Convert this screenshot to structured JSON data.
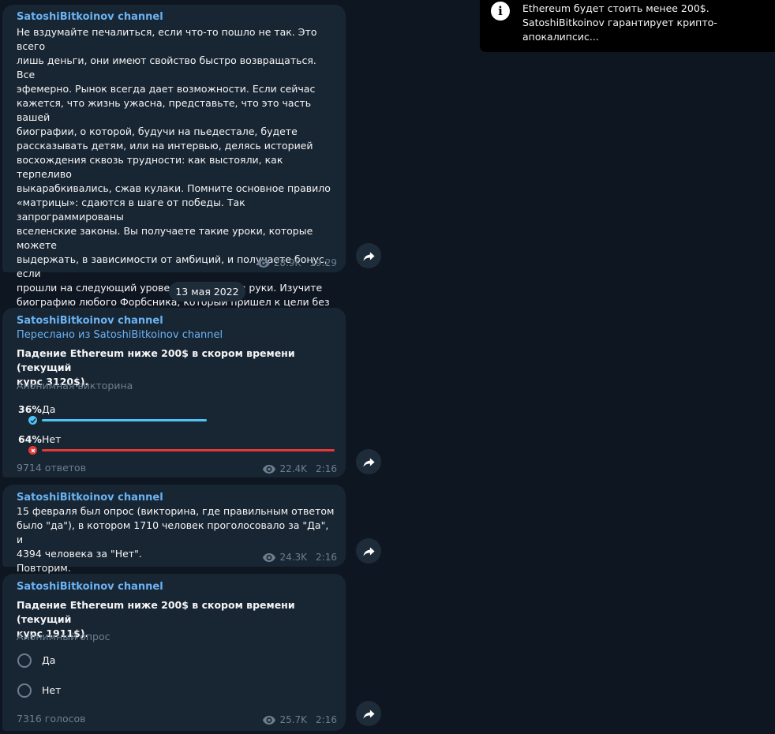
{
  "toast": {
    "icon": "info-icon",
    "text": "Ethereum будет стоить менее 200$.\nSatoshiBitkoinov гарантирует крипто-апокалипсис..."
  },
  "date_separator": "13 мая 2022",
  "messages": [
    {
      "author": "SatoshiBitkoinov channel",
      "text": "Не вздумайте печалиться, если что-то пошло не так. Это всего\nлишь деньги, они имеют свойство быстро возвращаться. Все\nэфемерно. Рынок всегда дает возможности. Если сейчас\nкажется, что жизнь ужасна, представьте, что это часть вашей\nбиографии, о которой, будучи на пьедестале, будете\nрассказывать детям, или на интервью, делясь историей\nвосхождения сквозь трудности: как выстояли, как терпеливо\nвыкарабкивались, сжав кулаки. Помните основное правило\n«матрицы»: сдаются в шаге от победы. Так запрограммированы\nвселенские законы. Вы получаете такие уроки, которые можете\nвыдержать, в зависимости от амбиций, и получаете бонус, если\nпрошли на следующий уровень, не опустив руки. Изучите\nбиографию любого Форбсника, который пришел к цели без\nпомощи родственников - падения делают сильнее и лучше. Это\nвсе игра. После трудностей и «разгрузок» приходят самые\nуспешные события.\nВсех благ",
      "views": "28.9K",
      "time": "19:29"
    },
    {
      "author": "SatoshiBitkoinov channel",
      "forwarded": "Переслано из SatoshiBitkoinov channel",
      "question": "Падение Ethereum ниже 200$ в скором времени (текущий\nкурс 3120$).",
      "quiz_type": "Анонимная викторина",
      "options": [
        {
          "percent": "36%",
          "label": "Да",
          "value": 36,
          "correct": true
        },
        {
          "percent": "64%",
          "label": "Нет",
          "value": 64,
          "correct": false
        }
      ],
      "answers": "9714 ответов",
      "views": "22.4K",
      "time": "2:16"
    },
    {
      "author": "SatoshiBitkoinov channel",
      "text": "15 февраля был опрос (викторина, где правильным ответом\nбыло \"да\"), в котором 1710 человек проголосовало за \"Да\", и\n4394 человека за \"Нет\".\nПовторим.",
      "views": "24.3K",
      "time": "2:16"
    },
    {
      "author": "SatoshiBitkoinov channel",
      "question": "Падение Ethereum ниже 200$ в скором времени (текущий\nкурс 1911$).",
      "poll_type": "Анонимный опрос",
      "options": [
        {
          "label": "Да"
        },
        {
          "label": "Нет"
        }
      ],
      "votes": "7316 голосов",
      "views": "25.7K",
      "time": "2:16"
    }
  ],
  "colors": {
    "background": "#0e1621",
    "bubble": "#182533",
    "accent": "#6ab3f3",
    "correct_bar": "#4fc3f7",
    "wrong_bar": "#e53935",
    "muted": "#6d7f8f"
  }
}
